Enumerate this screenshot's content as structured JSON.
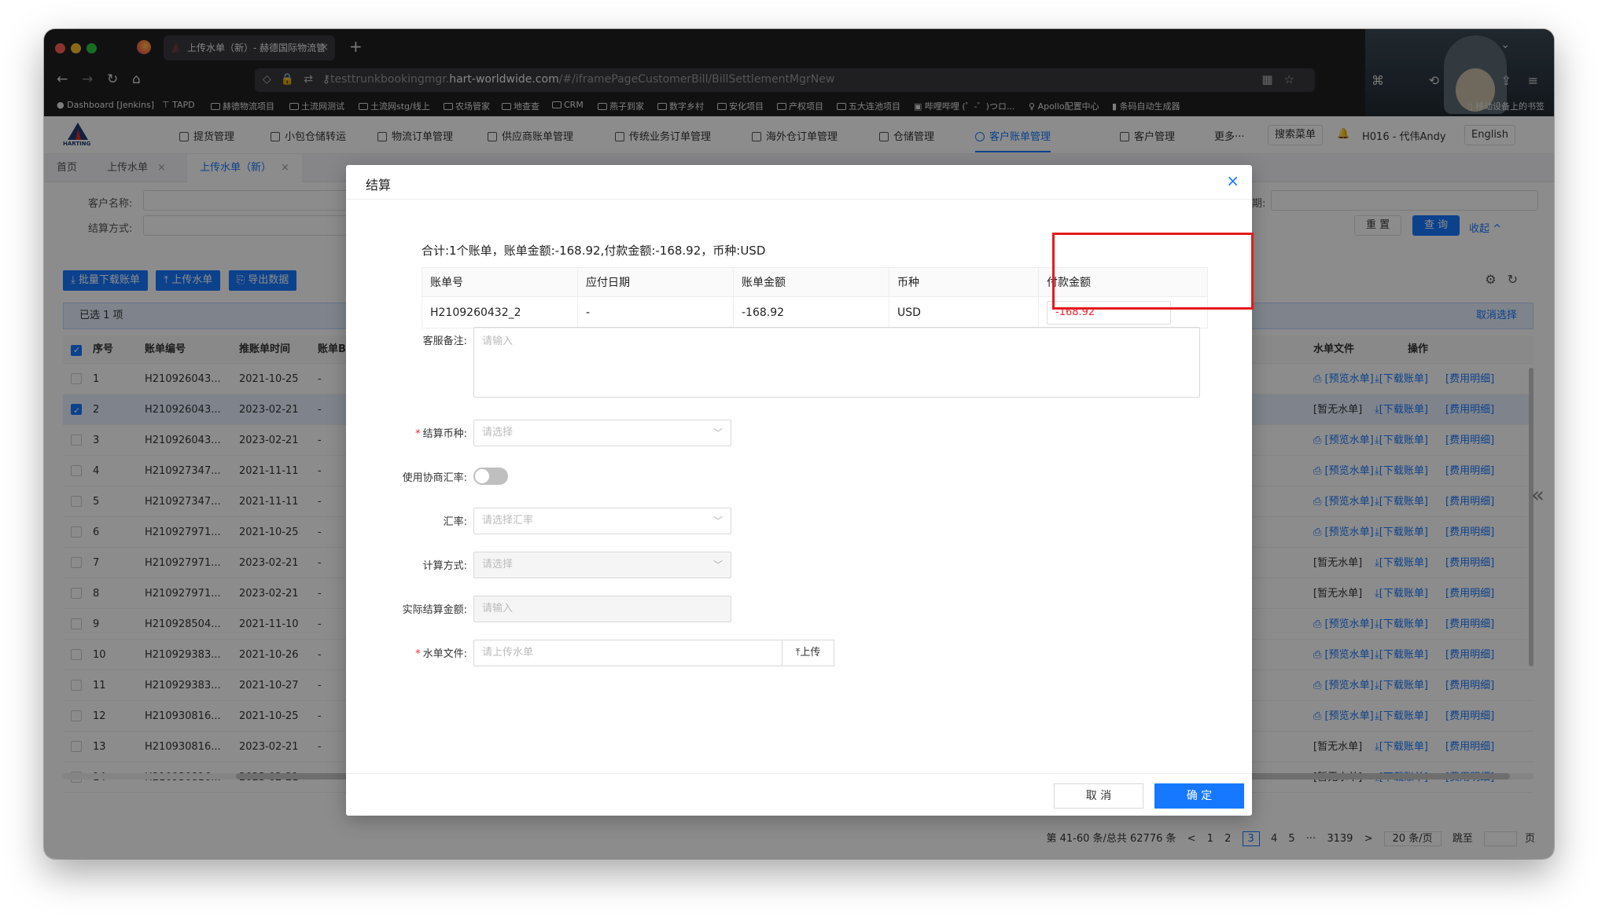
{
  "browser": {
    "tab_title": "上传水单（新）- 赫德国际物流管",
    "tab_close": "×",
    "new_tab": "+",
    "url_prefix": "testtrunkbookingmgr.",
    "url_host": "hart-worldwide.com",
    "url_path": "/#/iframePageCustomerBill/BillSettlementMgrNew",
    "bookmarks": [
      "Dashboard [Jenkins]",
      "TAPD",
      "赫德物流项目",
      "土流网测试",
      "土流网stg/线上",
      "农场管家",
      "地查查",
      "CRM",
      "燕子到家",
      "数字乡村",
      "安化项目",
      "产权项目",
      "五大连池项目",
      "哔哩哔哩 (゜-゜)つロ...",
      "Apollo配置中心",
      "条码自动生成器"
    ],
    "bookmarks_right": "移动设备上的书签"
  },
  "topnav": {
    "logo_text": "HARTING",
    "menu": [
      "提货管理",
      "小包仓储转运",
      "物流订单管理",
      "供应商账单管理",
      "传统业务订单管理",
      "海外仓订单管理",
      "仓储管理",
      "客户账单管理",
      "客户管理"
    ],
    "more": "更多···",
    "search_menu": "搜索菜单",
    "user": "H016 - 代伟Andy",
    "language": "English"
  },
  "page_tabs": [
    "首页",
    "上传水单",
    "上传水单（新）"
  ],
  "filter": {
    "customer_name_label": "客户名称:",
    "settle_method_label": "结算方式:",
    "date_label": "期:",
    "reset": "重 置",
    "query": "查 询",
    "collapse": "收起 ^"
  },
  "actions": [
    "批量下载账单",
    "上传水单",
    "导出数据"
  ],
  "selection": {
    "text": "已选 1 项",
    "clear": "取消选择"
  },
  "table": {
    "headers": [
      "序号",
      "账单编号",
      "推账单时间",
      "账单B",
      "水单文件",
      "操作"
    ],
    "rows": [
      {
        "no": "1",
        "bill": "H210926043...",
        "time": "2021-10-25",
        "col": "-",
        "file": "[预览水单]",
        "checked": false
      },
      {
        "no": "2",
        "bill": "H210926043...",
        "time": "2023-02-21",
        "col": "-",
        "file": "[暂无水单]",
        "checked": true
      },
      {
        "no": "3",
        "bill": "H210926043...",
        "time": "2023-02-21",
        "col": "-",
        "file": "[预览水单]",
        "checked": false
      },
      {
        "no": "4",
        "bill": "H210927347...",
        "time": "2021-11-11",
        "col": "-",
        "file": "[预览水单]",
        "checked": false
      },
      {
        "no": "5",
        "bill": "H210927347...",
        "time": "2021-11-11",
        "col": "-",
        "file": "[预览水单]",
        "checked": false
      },
      {
        "no": "6",
        "bill": "H210927971...",
        "time": "2021-10-25",
        "col": "-",
        "file": "[预览水单]",
        "checked": false
      },
      {
        "no": "7",
        "bill": "H210927971...",
        "time": "2023-02-21",
        "col": "-",
        "file": "[暂无水单]",
        "checked": false
      },
      {
        "no": "8",
        "bill": "H210927971...",
        "time": "2023-02-21",
        "col": "-",
        "file": "[暂无水单]",
        "checked": false
      },
      {
        "no": "9",
        "bill": "H210928504...",
        "time": "2021-11-10",
        "col": "-",
        "file": "[预览水单]",
        "checked": false
      },
      {
        "no": "10",
        "bill": "H210929383...",
        "time": "2021-10-26",
        "col": "-",
        "file": "[预览水单]",
        "checked": false
      },
      {
        "no": "11",
        "bill": "H210929383...",
        "time": "2021-10-27",
        "col": "-",
        "file": "[预览水单]",
        "checked": false
      },
      {
        "no": "12",
        "bill": "H210930816...",
        "time": "2021-10-25",
        "col": "-",
        "file": "[预览水单]",
        "checked": false
      },
      {
        "no": "13",
        "bill": "H210930816...",
        "time": "2023-02-21",
        "col": "-",
        "file": "[暂无水单]",
        "checked": false
      },
      {
        "no": "14",
        "bill": "H210930816...",
        "time": "2023-02-21",
        "col": "-",
        "file": "[暂无水单]",
        "checked": false
      }
    ],
    "op_download": "[下载账单]",
    "op_detail": "[费用明细]"
  },
  "pager": {
    "summary": "第 41-60 条/总共 62776 条",
    "prev": "<",
    "pages": [
      "1",
      "2",
      "3",
      "4",
      "5"
    ],
    "ellipsis": "···",
    "last": "3139",
    "next": ">",
    "page_size": "20 条/页",
    "jump": "跳至",
    "page_unit": "页"
  },
  "modal": {
    "title": "结算",
    "close": "×",
    "summary": "合计:1个账单，账单金额:-168.92,付款金额:-168.92，币种:USD",
    "bill_table": {
      "headers": [
        "账单号",
        "应付日期",
        "账单金额",
        "币种",
        "付款金额"
      ],
      "row": {
        "bill_no": "H2109260432_2",
        "due_date": "-",
        "amount": "-168.92",
        "currency": "USD",
        "pay_amount": "-168.92"
      }
    },
    "fields": {
      "remark_label": "客服备注:",
      "remark_placeholder": "请输入",
      "currency_label": "结算币种:",
      "currency_placeholder": "请选择",
      "agreement_rate_label": "使用协商汇率:",
      "rate_label": "汇率:",
      "rate_placeholder": "请选择汇率",
      "calc_label": "计算方式:",
      "calc_placeholder": "请选择",
      "actual_label": "实际结算金额:",
      "actual_placeholder": "请输入",
      "file_label": "水单文件:",
      "file_placeholder": "请上传水单",
      "upload": "上传"
    },
    "cancel": "取 消",
    "ok": "确 定"
  },
  "colors": {
    "primary": "#1677ff",
    "negative": "#f5222d",
    "highlight_box": "#e41b1b"
  }
}
